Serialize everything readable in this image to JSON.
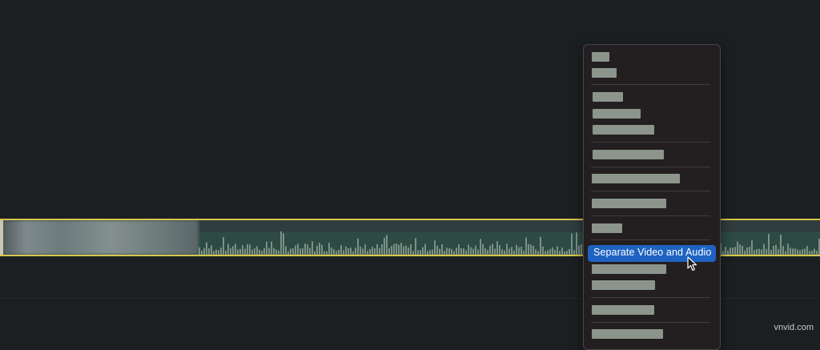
{
  "colors": {
    "background": "#1c1f22",
    "clip_border": "#d8c64a",
    "audio_fill": "#2d4a44",
    "waveform": "#7c9084",
    "menu_bg": "#231f20",
    "highlight": "#1f63c2"
  },
  "context_menu": {
    "highlighted_item_label": "Separate Video and Audio"
  },
  "cursor_icon": "arrow-pointer-icon",
  "watermark": "vnvid.com"
}
